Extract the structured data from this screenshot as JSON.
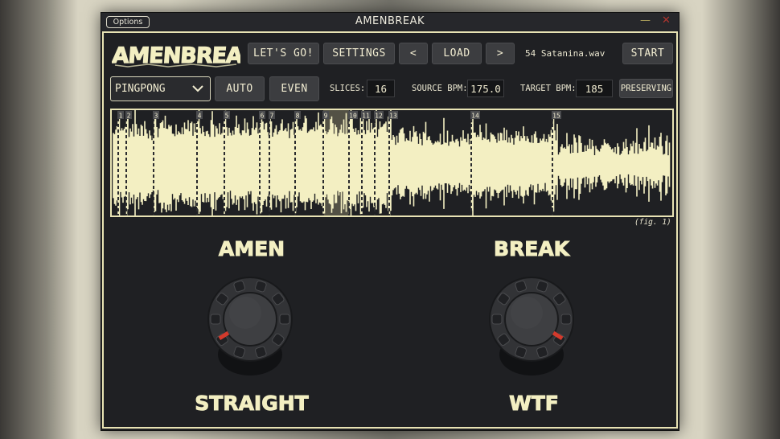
{
  "window": {
    "options_label": "Options",
    "title": "AMENBREAK",
    "minimize_glyph": "—",
    "close_glyph": "✕"
  },
  "logo": {
    "text": "AMENBREAK"
  },
  "toolbar": {
    "lets_go": "LET'S GO!",
    "settings": "SETTINGS",
    "prev": "<",
    "load": "LOAD",
    "next": ">",
    "file_name": "54 Satanina.wav",
    "start": "START"
  },
  "controls": {
    "mode_value": "PINGPONG",
    "auto": "AUTO",
    "even": "EVEN",
    "slices_label": "SLICES:",
    "slices_value": "16",
    "source_bpm_label": "SOURCE BPM:",
    "source_bpm_value": "175.0",
    "target_bpm_label": "TARGET BPM:",
    "target_bpm_value": "185",
    "preserving": "PRESERVING"
  },
  "waveform": {
    "markers": [
      "1",
      "2",
      "3",
      "4",
      "5",
      "6",
      "7",
      "8",
      "9",
      "10",
      "11",
      "12",
      "13",
      "14",
      "15"
    ],
    "selected_slice": "9",
    "caption": "(fig. 1)"
  },
  "knobs": {
    "left": {
      "top_label": "AMEN",
      "bottom_label": "STRAIGHT",
      "level": 0.0
    },
    "right": {
      "top_label": "BREAK",
      "bottom_label": "WTF",
      "level": 1.0
    }
  },
  "colors": {
    "accent": "#f3efc2",
    "background": "#1f2023",
    "knob_indicator": "#d33a2c"
  }
}
